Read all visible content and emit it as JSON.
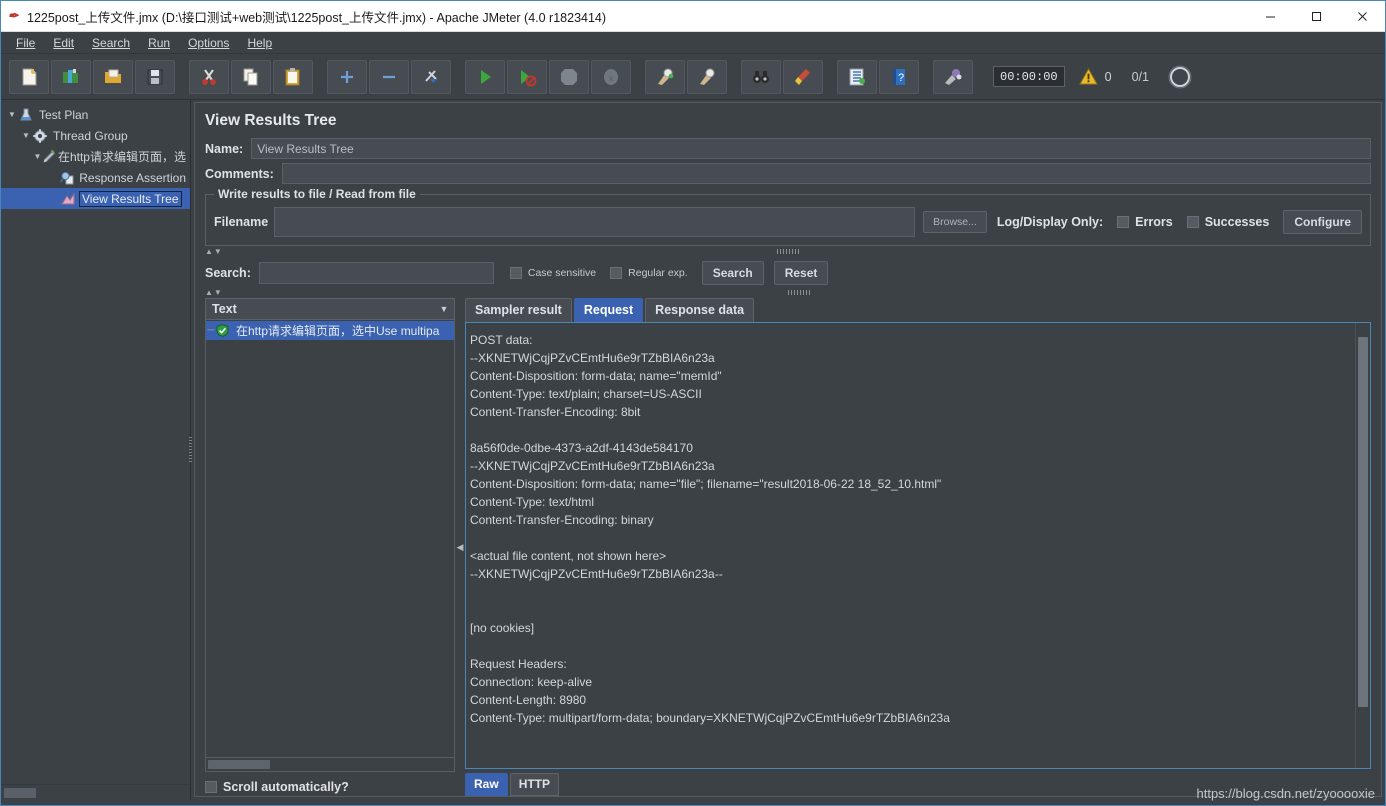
{
  "window": {
    "title": "1225post_上传文件.jmx (D:\\接口测试+web测试\\1225post_上传文件.jmx) - Apache JMeter (4.0 r1823414)",
    "app_icon": "jmeter-feather-icon",
    "minimize": "minimize-icon",
    "maximize": "maximize-icon",
    "close": "close-icon"
  },
  "menubar": {
    "items": [
      {
        "label": "File",
        "mnemonic": "F"
      },
      {
        "label": "Edit",
        "mnemonic": "E"
      },
      {
        "label": "Search",
        "mnemonic": "S"
      },
      {
        "label": "Run",
        "mnemonic": "R"
      },
      {
        "label": "Options",
        "mnemonic": "O"
      },
      {
        "label": "Help",
        "mnemonic": "H"
      }
    ]
  },
  "toolbar": {
    "buttons": [
      {
        "name": "new-button",
        "icon": "new-document-icon"
      },
      {
        "name": "templates-button",
        "icon": "templates-icon"
      },
      {
        "name": "open-button",
        "icon": "open-folder-icon"
      },
      {
        "name": "save-button",
        "icon": "save-floppy-icon"
      },
      {
        "name": "cut-button",
        "icon": "scissors-icon"
      },
      {
        "name": "copy-button",
        "icon": "copy-icon"
      },
      {
        "name": "paste-button",
        "icon": "clipboard-paste-icon"
      },
      {
        "name": "expand-all-button",
        "icon": "plus-icon"
      },
      {
        "name": "collapse-all-button",
        "icon": "minus-icon"
      },
      {
        "name": "toggle-button",
        "icon": "toggle-icon"
      },
      {
        "name": "start-button",
        "icon": "play-green-icon"
      },
      {
        "name": "start-no-pauses-button",
        "icon": "play-no-timers-icon"
      },
      {
        "name": "stop-button",
        "icon": "stop-icon"
      },
      {
        "name": "shutdown-button",
        "icon": "shutdown-icon"
      },
      {
        "name": "clear-button",
        "icon": "clear-icon"
      },
      {
        "name": "clear-all-button",
        "icon": "clear-all-icon"
      },
      {
        "name": "search-button",
        "icon": "binoculars-icon"
      },
      {
        "name": "search-reset-button",
        "icon": "broom-icon"
      },
      {
        "name": "function-helper-button",
        "icon": "function-list-icon"
      },
      {
        "name": "help-button",
        "icon": "help-book-icon"
      },
      {
        "name": "remote-start-button",
        "icon": "remote-start-icon"
      }
    ],
    "timer": "00:00:00",
    "warning_icon": "warning-triangle-icon",
    "warning_count": "0",
    "thread_count": "0/1",
    "grid_icon": "grid-sphere-icon"
  },
  "tree": {
    "items": [
      {
        "label": "Test Plan",
        "icon": "test-plan-icon",
        "twisty": "▼",
        "indent": 0,
        "selected": false
      },
      {
        "label": "Thread Group",
        "icon": "thread-group-gear-icon",
        "twisty": "▼",
        "indent": 1,
        "selected": false
      },
      {
        "label": "在http请求编辑页面，选",
        "icon": "http-request-icon",
        "twisty": "▼",
        "indent": 2,
        "selected": false
      },
      {
        "label": "Response Assertion",
        "icon": "assertion-magnifier-icon",
        "twisty": "",
        "indent": 3,
        "selected": false
      },
      {
        "label": "View Results Tree",
        "icon": "view-results-tree-icon",
        "twisty": "",
        "indent": 3,
        "selected": true
      }
    ]
  },
  "panel": {
    "title": "View Results Tree",
    "name_label": "Name:",
    "name_value": "View Results Tree",
    "comments_label": "Comments:",
    "comments_value": "",
    "filegroup": {
      "title": "Write results to file / Read from file",
      "filename_label": "Filename",
      "filename_value": "",
      "browse_label": "Browse...",
      "logdisplay_label": "Log/Display Only:",
      "errors_label": "Errors",
      "errors_checked": false,
      "successes_label": "Successes",
      "successes_checked": false,
      "configure_label": "Configure"
    },
    "search": {
      "label": "Search:",
      "value": "",
      "case_sensitive_label": "Case sensitive",
      "case_sensitive_checked": false,
      "regex_label": "Regular exp.",
      "regex_checked": false,
      "search_button": "Search",
      "reset_button": "Reset"
    },
    "renderer": {
      "selected": "Text",
      "dropdown_icon": "chevron-down-icon"
    },
    "results": [
      {
        "label": "在http请求编辑页面，选中Use multipa",
        "icon": "success-shield-icon",
        "selected": true
      }
    ],
    "scroll_auto_label": "Scroll automatically?",
    "scroll_auto_checked": false,
    "tabs": [
      {
        "label": "Sampler result",
        "active": false
      },
      {
        "label": "Request",
        "active": true
      },
      {
        "label": "Response data",
        "active": false
      }
    ],
    "request_lines": [
      "POST data:",
      "--XKNETWjCqjPZvCEmtHu6e9rTZbBIA6n23a",
      "Content-Disposition: form-data; name=\"memId\"",
      "Content-Type: text/plain; charset=US-ASCII",
      "Content-Transfer-Encoding: 8bit",
      "",
      "8a56f0de-0dbe-4373-a2df-4143de584170",
      "--XKNETWjCqjPZvCEmtHu6e9rTZbBIA6n23a",
      "Content-Disposition: form-data; name=\"file\"; filename=\"result2018-06-22 18_52_10.html\"",
      "Content-Type: text/html",
      "Content-Transfer-Encoding: binary",
      "",
      "<actual file content, not shown here>",
      "--XKNETWjCqjPZvCEmtHu6e9rTZbBIA6n23a--",
      "",
      "",
      "[no cookies]",
      "",
      "Request Headers:",
      "Connection: keep-alive",
      "Content-Length: 8980",
      "Content-Type: multipart/form-data; boundary=XKNETWjCqjPZvCEmtHu6e9rTZbBIA6n23a"
    ],
    "view_tabs": [
      {
        "label": "Raw",
        "active": true
      },
      {
        "label": "HTTP",
        "active": false
      }
    ]
  },
  "watermark": "https://blog.csdn.net/zyooooxie",
  "colors": {
    "accent": "#3a62b0",
    "panel_bg": "#3c4146",
    "text": "#d3d7db",
    "border": "#5d6369"
  }
}
